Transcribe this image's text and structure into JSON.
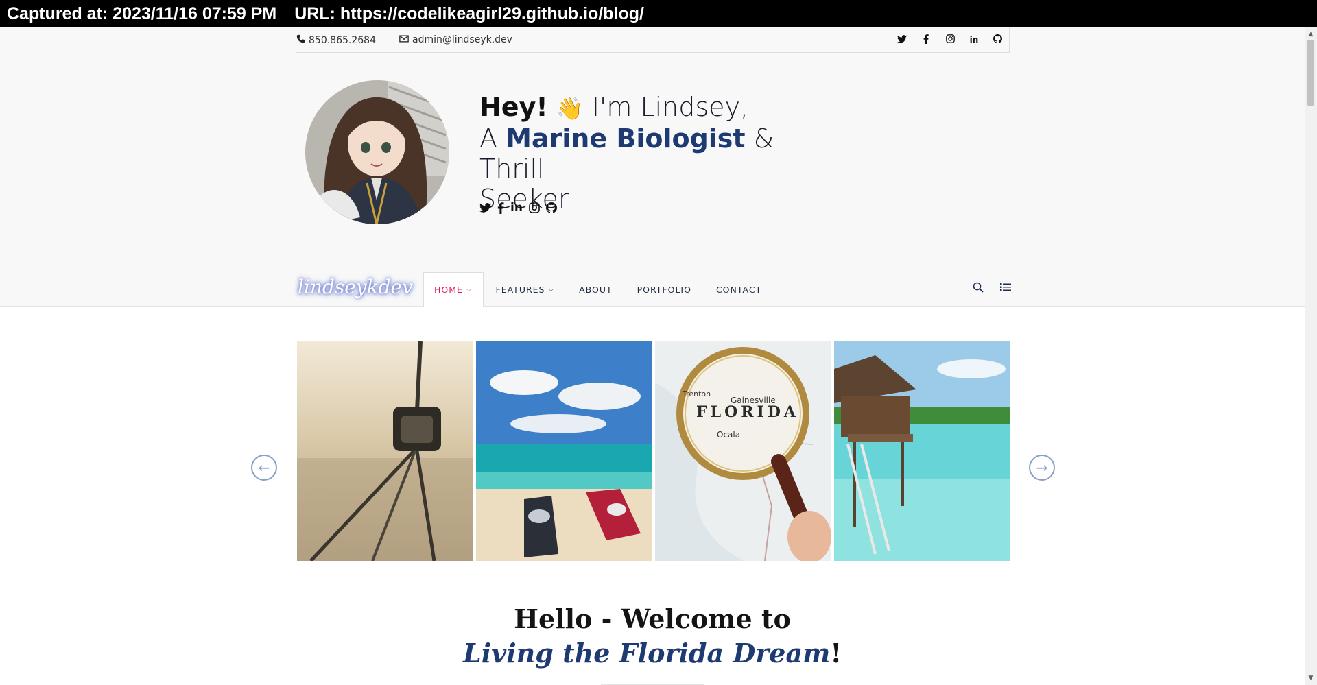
{
  "capture": {
    "captured_at": "Captured at: 2023/11/16 07:59 PM",
    "url": "URL: https://codelikeagirl29.github.io/blog/"
  },
  "topbar": {
    "phone": "850.865.2684",
    "email": "admin@lindseyk.dev",
    "phone_icon": "phone-icon",
    "email_icon": "envelope-icon",
    "socials": [
      {
        "name": "twitter-icon",
        "glyph": "🐦"
      },
      {
        "name": "facebook-icon",
        "glyph": "f"
      },
      {
        "name": "instagram-icon",
        "glyph": "◎"
      },
      {
        "name": "linkedin-icon",
        "glyph": "in"
      },
      {
        "name": "github-icon",
        "glyph": "●"
      }
    ]
  },
  "hero": {
    "greeting": "Hey!",
    "wave": "👋",
    "intro": " I'm Lindsey,",
    "line2_prefix": "A ",
    "role": "Marine Biologist",
    "line2_suffix": " & Thrill",
    "line3": "Seeker",
    "social_icons": [
      "twitter-icon",
      "facebook-icon",
      "linkedin-icon",
      "instagram-icon",
      "github-icon"
    ]
  },
  "nav": {
    "logo": "lindseykdev",
    "items": [
      {
        "label": "HOME",
        "dropdown": true,
        "active": true
      },
      {
        "label": "FEATURES",
        "dropdown": true,
        "active": false
      },
      {
        "label": "ABOUT",
        "dropdown": false,
        "active": false
      },
      {
        "label": "PORTFOLIO",
        "dropdown": false,
        "active": false
      },
      {
        "label": "CONTACT",
        "dropdown": false,
        "active": false
      }
    ],
    "search_icon": "search-icon",
    "menu_icon": "list-icon"
  },
  "gallery": {
    "images": [
      {
        "name": "sextant-beach-image"
      },
      {
        "name": "jet-skis-beach-image"
      },
      {
        "name": "florida-map-magnifier-image"
      },
      {
        "name": "overwater-bungalow-image"
      }
    ],
    "prev_label": "←",
    "next_label": "→"
  },
  "welcome": {
    "line1": "Hello - Welcome to",
    "line2_ital": "Living the Florida Dream",
    "line2_end": "!"
  },
  "colors": {
    "accent_blue": "#1d3a73",
    "nav_active": "#e2175b",
    "header_bg": "#f8f8f8"
  }
}
